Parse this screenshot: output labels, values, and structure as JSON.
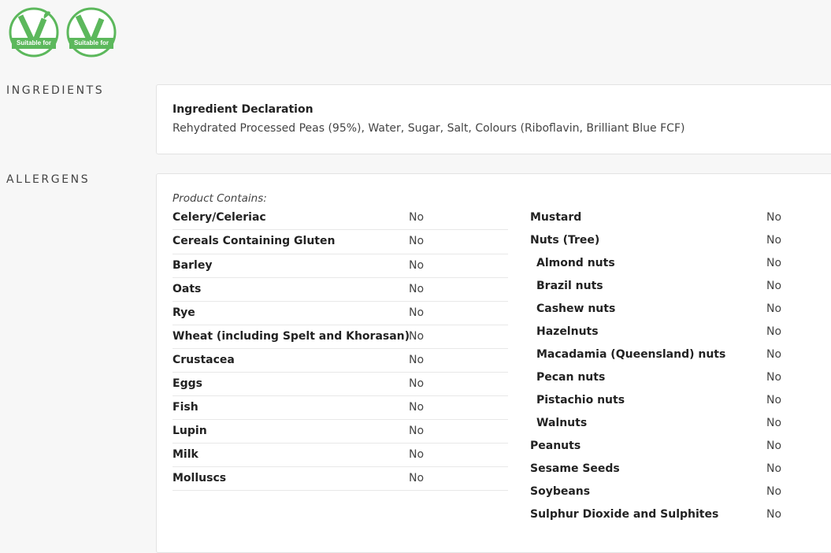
{
  "badges": [
    {
      "label": "Suitable for",
      "color": "#5cb85c"
    },
    {
      "label": "Suitable for",
      "color": "#5cb85c"
    }
  ],
  "ingredients": {
    "section_label": "INGREDIENTS",
    "title": "Ingredient Declaration",
    "text": "Rehydrated Processed Peas (95%), Water, Sugar, Salt, Colours (Riboflavin, Brilliant Blue FCF)"
  },
  "allergens": {
    "section_label": "ALLERGENS",
    "contains_label": "Product Contains:",
    "left": [
      {
        "name": "Celery/Celeriac",
        "value": "No",
        "sub": false
      },
      {
        "name": "Cereals Containing Gluten",
        "value": "No",
        "sub": false
      },
      {
        "name": "Barley",
        "value": "No",
        "sub": false
      },
      {
        "name": "Oats",
        "value": "No",
        "sub": false
      },
      {
        "name": "Rye",
        "value": "No",
        "sub": false
      },
      {
        "name": "Wheat (including Spelt and Khorasan)",
        "value": "No",
        "sub": false
      },
      {
        "name": "Crustacea",
        "value": "No",
        "sub": false
      },
      {
        "name": "Eggs",
        "value": "No",
        "sub": false
      },
      {
        "name": "Fish",
        "value": "No",
        "sub": false
      },
      {
        "name": "Lupin",
        "value": "No",
        "sub": false
      },
      {
        "name": "Milk",
        "value": "No",
        "sub": false
      },
      {
        "name": "Molluscs",
        "value": "No",
        "sub": false
      }
    ],
    "right": [
      {
        "name": "Mustard",
        "value": "No",
        "sub": false
      },
      {
        "name": "Nuts (Tree)",
        "value": "No",
        "sub": false
      },
      {
        "name": "Almond nuts",
        "value": "No",
        "sub": true
      },
      {
        "name": "Brazil nuts",
        "value": "No",
        "sub": true
      },
      {
        "name": "Cashew nuts",
        "value": "No",
        "sub": true
      },
      {
        "name": "Hazelnuts",
        "value": "No",
        "sub": true
      },
      {
        "name": "Macadamia (Queensland) nuts",
        "value": "No",
        "sub": true
      },
      {
        "name": "Pecan nuts",
        "value": "No",
        "sub": true
      },
      {
        "name": "Pistachio nuts",
        "value": "No",
        "sub": true
      },
      {
        "name": "Walnuts",
        "value": "No",
        "sub": true
      },
      {
        "name": "Peanuts",
        "value": "No",
        "sub": false
      },
      {
        "name": "Sesame Seeds",
        "value": "No",
        "sub": false
      },
      {
        "name": "Soybeans",
        "value": "No",
        "sub": false
      },
      {
        "name": "Sulphur Dioxide and Sulphites",
        "value": "No",
        "sub": false
      }
    ]
  }
}
